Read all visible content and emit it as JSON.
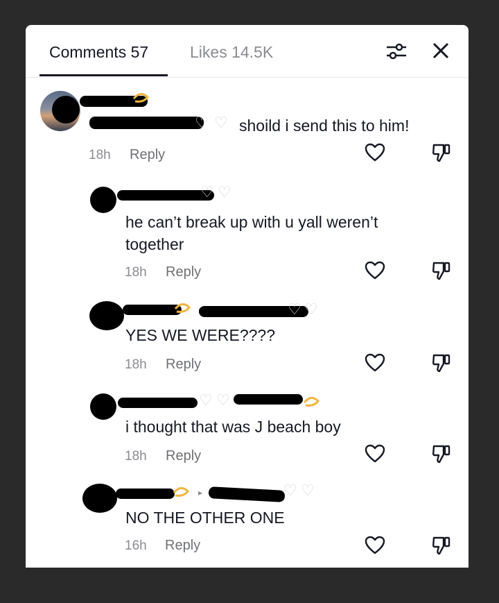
{
  "tabs": {
    "comments": "Comments 57",
    "likes": "Likes 14.5K"
  },
  "icons": {
    "filter": "filter-sliders-icon",
    "close": "close-icon",
    "like": "heart-outline-icon",
    "dislike": "thumbs-down-icon"
  },
  "comments": [
    {
      "text": "shoild i send this to him!",
      "time": "18h",
      "reply": "Reply"
    },
    {
      "text": "he can’t break up with u yall weren’t together",
      "time": "18h",
      "reply": "Reply"
    },
    {
      "text": "YES WE WERE????",
      "time": "18h",
      "reply": "Reply"
    },
    {
      "text": "i thought that was J beach boy",
      "time": "18h",
      "reply": "Reply"
    },
    {
      "text": "NO THE OTHER ONE",
      "time": "16h",
      "reply": "Reply"
    }
  ]
}
